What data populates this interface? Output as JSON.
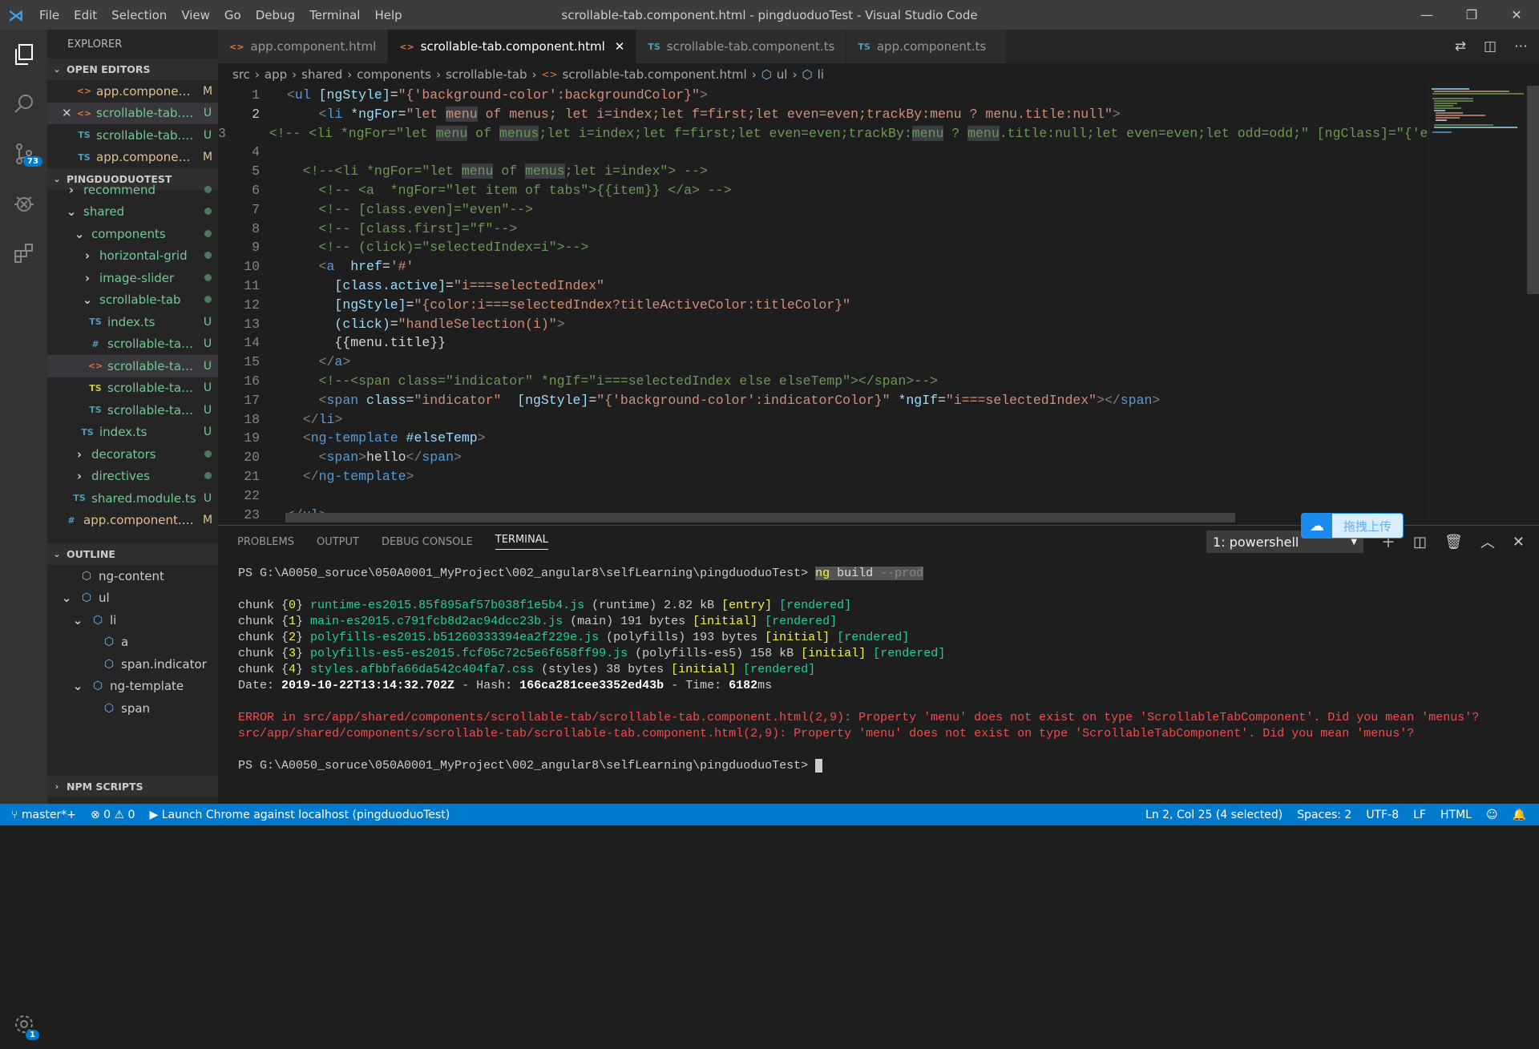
{
  "titlebar": {
    "menu": [
      "File",
      "Edit",
      "Selection",
      "View",
      "Go",
      "Debug",
      "Terminal",
      "Help"
    ],
    "title": "scrollable-tab.component.html - pingduoduoTest - Visual Studio Code"
  },
  "activity": {
    "scm_badge": "73",
    "settings_badge": "1"
  },
  "sidebar": {
    "header": "EXPLORER",
    "open_editors_label": "OPEN EDITORS",
    "open_editors": [
      {
        "icon": "<>",
        "label": "app.component.html",
        "status": "M",
        "cls": "m",
        "ic": "#e37933"
      },
      {
        "icon": "<>",
        "label": "scrollable-tab.component.html",
        "status": "U",
        "cls": "u",
        "ic": "#e37933",
        "selected": true
      },
      {
        "icon": "TS",
        "label": "scrollable-tab.component.ts",
        "status": "U",
        "cls": "u",
        "ic": "#519aba"
      },
      {
        "icon": "TS",
        "label": "app.component.ts",
        "status": "M",
        "cls": "m",
        "ic": "#519aba"
      }
    ],
    "project_label": "PINGDUODUOTEST",
    "tree": [
      {
        "indent": 2,
        "chev": ">",
        "label": "recommend",
        "status": "dot"
      },
      {
        "indent": 2,
        "chev": "v",
        "label": "shared",
        "status": "dot"
      },
      {
        "indent": 3,
        "chev": "v",
        "label": "components",
        "status": "dot"
      },
      {
        "indent": 4,
        "chev": ">",
        "label": "horizontal-grid",
        "status": "dot"
      },
      {
        "indent": 4,
        "chev": ">",
        "label": "image-slider",
        "status": "dot"
      },
      {
        "indent": 4,
        "chev": "v",
        "label": "scrollable-tab",
        "status": "dot"
      },
      {
        "indent": 5,
        "icon": "TS",
        "ic": "#519aba",
        "label": "index.ts",
        "status": "U"
      },
      {
        "indent": 5,
        "icon": "#",
        "ic": "#519aba",
        "label": "scrollable-tab.component.css",
        "status": "U"
      },
      {
        "indent": 5,
        "icon": "<>",
        "ic": "#e37933",
        "label": "scrollable-tab.component.html",
        "status": "U",
        "selected": true
      },
      {
        "indent": 5,
        "icon": "TS",
        "ic": "#cbcb41",
        "label": "scrollable-tab.component.spec.ts",
        "status": "U"
      },
      {
        "indent": 5,
        "icon": "TS",
        "ic": "#519aba",
        "label": "scrollable-tab.component.ts",
        "status": "U"
      },
      {
        "indent": 4,
        "icon": "TS",
        "ic": "#519aba",
        "label": "index.ts",
        "status": "U"
      },
      {
        "indent": 3,
        "chev": ">",
        "label": "decorators",
        "status": "dot"
      },
      {
        "indent": 3,
        "chev": ">",
        "label": "directives",
        "status": "dot"
      },
      {
        "indent": 3,
        "icon": "TS",
        "ic": "#519aba",
        "label": "shared.module.ts",
        "status": "U"
      },
      {
        "indent": 2,
        "icon": "#",
        "ic": "#519aba",
        "label": "app.component.css",
        "status": "M",
        "m": true
      }
    ],
    "outline_label": "OUTLINE",
    "outline": [
      {
        "indent": 1,
        "label": "ng-content"
      },
      {
        "indent": 1,
        "chev": "v",
        "label": "ul"
      },
      {
        "indent": 2,
        "chev": "v",
        "label": "li"
      },
      {
        "indent": 3,
        "label": "a"
      },
      {
        "indent": 3,
        "label": "span.indicator"
      },
      {
        "indent": 2,
        "chev": "v",
        "label": "ng-template"
      },
      {
        "indent": 3,
        "label": "span"
      }
    ],
    "npm_label": "NPM SCRIPTS"
  },
  "tabs": [
    {
      "icon": "<>",
      "ic": "#e37933",
      "label": "app.component.html"
    },
    {
      "icon": "<>",
      "ic": "#e37933",
      "label": "scrollable-tab.component.html",
      "active": true
    },
    {
      "icon": "TS",
      "ic": "#519aba",
      "label": "scrollable-tab.component.ts"
    },
    {
      "icon": "TS",
      "ic": "#519aba",
      "label": "app.component.ts"
    }
  ],
  "breadcrumb": [
    "src",
    "app",
    "shared",
    "components",
    "scrollable-tab",
    "scrollable-tab.component.html",
    "ul",
    "li"
  ],
  "code": [
    [
      [
        "<",
        "p"
      ],
      [
        "ul",
        "tag"
      ],
      [
        " ",
        ""
      ],
      [
        "[ngStyle]",
        "attr"
      ],
      [
        "=",
        "tx"
      ],
      [
        "\"{'background-color':backgroundColor}\"",
        "str"
      ],
      [
        ">",
        "p"
      ]
    ],
    [
      [
        "    ",
        ""
      ],
      [
        "<",
        "p"
      ],
      [
        "li",
        "tag"
      ],
      [
        " ",
        ""
      ],
      [
        "*ngFor",
        "attr"
      ],
      [
        "=",
        "tx"
      ],
      [
        "\"let ",
        "str"
      ],
      [
        "menu",
        "str hl"
      ],
      [
        " of ",
        "str"
      ],
      [
        "menus",
        "str"
      ],
      [
        "; let i=index;let f=first;let even=even;trackBy:",
        "str"
      ],
      [
        "menu",
        "str"
      ],
      [
        " ? ",
        "str"
      ],
      [
        "menu",
        "str"
      ],
      [
        ".title:null\"",
        "str"
      ],
      [
        ">",
        "p"
      ]
    ],
    [
      [
        "  <!-- <li *ngFor=\"let ",
        "cm"
      ],
      [
        "menu",
        "cm hl"
      ],
      [
        " of ",
        "cm"
      ],
      [
        "menus",
        "cm hl"
      ],
      [
        ";let i=index;let f=first;let even=even;trackBy:",
        "cm"
      ],
      [
        "menu",
        "cm hl"
      ],
      [
        " ? ",
        "cm"
      ],
      [
        "menu",
        "cm hl"
      ],
      [
        ".title:null;let even=even;let odd=odd;\" [ngClass]=\"{'ev",
        "cm"
      ]
    ],
    [],
    [
      [
        "  <!--<li *ngFor=\"let ",
        "cm"
      ],
      [
        "menu",
        "cm hl"
      ],
      [
        " of ",
        "cm"
      ],
      [
        "menus",
        "cm hl"
      ],
      [
        ";let i=index\"> -->",
        "cm"
      ]
    ],
    [
      [
        "    <!-- <a  *ngFor=\"let item of tabs\">{{item}} </a> -->",
        "cm"
      ]
    ],
    [
      [
        "    <!-- [class.even]=\"even\"-->",
        "cm"
      ]
    ],
    [
      [
        "    <!-- [class.first]=\"f\"-->",
        "cm"
      ]
    ],
    [
      [
        "    <!-- (click)=\"selectedIndex=i\">-->",
        "cm"
      ]
    ],
    [
      [
        "    ",
        ""
      ],
      [
        "<",
        "p"
      ],
      [
        "a",
        "tag"
      ],
      [
        "  ",
        ""
      ],
      [
        "href",
        "attr"
      ],
      [
        "=",
        "tx"
      ],
      [
        "'#'",
        "str"
      ]
    ],
    [
      [
        "      ",
        ""
      ],
      [
        "[class.active]",
        "attr"
      ],
      [
        "=",
        "tx"
      ],
      [
        "\"i===selectedIndex\"",
        "str"
      ]
    ],
    [
      [
        "      ",
        ""
      ],
      [
        "[ngStyle]",
        "attr"
      ],
      [
        "=",
        "tx"
      ],
      [
        "\"{color:i===selectedIndex?titleActiveColor:titleColor}\"",
        "str"
      ]
    ],
    [
      [
        "      ",
        ""
      ],
      [
        "(click)",
        "attr"
      ],
      [
        "=",
        "tx"
      ],
      [
        "\"handleSelection(i)\"",
        "str"
      ],
      [
        ">",
        "p"
      ]
    ],
    [
      [
        "      {{menu.title}}",
        "tx"
      ]
    ],
    [
      [
        "    ",
        ""
      ],
      [
        "</",
        "p"
      ],
      [
        "a",
        "tag"
      ],
      [
        ">",
        "p"
      ]
    ],
    [
      [
        "    <!--<span class=\"indicator\" *ngIf=\"i===selectedIndex else elseTemp\"></span>-->",
        "cm"
      ]
    ],
    [
      [
        "    ",
        ""
      ],
      [
        "<",
        "p"
      ],
      [
        "span",
        "tag"
      ],
      [
        " ",
        ""
      ],
      [
        "class",
        "attr"
      ],
      [
        "=",
        "tx"
      ],
      [
        "\"indicator\"",
        "str"
      ],
      [
        "  ",
        ""
      ],
      [
        "[ngStyle]",
        "attr"
      ],
      [
        "=",
        "tx"
      ],
      [
        "\"{'background-color':indicatorColor}\"",
        "str"
      ],
      [
        " ",
        ""
      ],
      [
        "*ngIf",
        "attr"
      ],
      [
        "=",
        "tx"
      ],
      [
        "\"i===selectedIndex\"",
        "str"
      ],
      [
        "></",
        "p"
      ],
      [
        "span",
        "tag"
      ],
      [
        ">",
        "p"
      ]
    ],
    [
      [
        "  ",
        ""
      ],
      [
        "</",
        "p"
      ],
      [
        "li",
        "tag"
      ],
      [
        ">",
        "p"
      ]
    ],
    [
      [
        "  ",
        ""
      ],
      [
        "<",
        "p"
      ],
      [
        "ng-template",
        "tag"
      ],
      [
        " ",
        ""
      ],
      [
        "#elseTemp",
        "attr"
      ],
      [
        ">",
        "p"
      ]
    ],
    [
      [
        "    ",
        ""
      ],
      [
        "<",
        "p"
      ],
      [
        "span",
        "tag"
      ],
      [
        ">",
        "p"
      ],
      [
        "hello",
        "tx"
      ],
      [
        "</",
        "p"
      ],
      [
        "span",
        "tag"
      ],
      [
        ">",
        "p"
      ]
    ],
    [
      [
        "  ",
        ""
      ],
      [
        "</",
        "p"
      ],
      [
        "ng-template",
        "tag"
      ],
      [
        ">",
        "p"
      ]
    ],
    [],
    [
      [
        "</",
        "p"
      ],
      [
        "ul",
        "tag"
      ],
      [
        ">",
        "p"
      ]
    ]
  ],
  "cursor_line": 2,
  "panel": {
    "tabs": [
      "PROBLEMS",
      "OUTPUT",
      "DEBUG CONSOLE",
      "TERMINAL"
    ],
    "active": "TERMINAL",
    "shell": "1: powershell",
    "upload_label": "拖拽上传"
  },
  "terminal": [
    [
      [
        "PS G:\\A0050_soruce\\050A0001_MyProject\\002_angular8\\selfLearning\\pingduoduoTest> ",
        "t-w"
      ],
      [
        "ng",
        "t-hl"
      ],
      [
        " build ",
        "t-hlw"
      ],
      [
        "--prod",
        "t-dim"
      ]
    ],
    [],
    [
      [
        "chunk {",
        "t-w"
      ],
      [
        "0",
        "t-y"
      ],
      [
        "} ",
        "t-w"
      ],
      [
        "runtime-es2015.85f895af57b038f1e5b4.js",
        "t-g"
      ],
      [
        " (runtime) 2.82 kB ",
        "t-w"
      ],
      [
        "[entry]",
        "t-y"
      ],
      [
        " ",
        "t-w"
      ],
      [
        "[rendered]",
        "t-g"
      ]
    ],
    [
      [
        "chunk {",
        "t-w"
      ],
      [
        "1",
        "t-y"
      ],
      [
        "} ",
        "t-w"
      ],
      [
        "main-es2015.c791fcb8d2ac94dcc23b.js",
        "t-g"
      ],
      [
        " (main) 191 bytes ",
        "t-w"
      ],
      [
        "[initial]",
        "t-y"
      ],
      [
        " ",
        "t-w"
      ],
      [
        "[rendered]",
        "t-g"
      ]
    ],
    [
      [
        "chunk {",
        "t-w"
      ],
      [
        "2",
        "t-y"
      ],
      [
        "} ",
        "t-w"
      ],
      [
        "polyfills-es2015.b51260333394ea2f229e.js",
        "t-g"
      ],
      [
        " (polyfills) 193 bytes ",
        "t-w"
      ],
      [
        "[initial]",
        "t-y"
      ],
      [
        " ",
        "t-w"
      ],
      [
        "[rendered]",
        "t-g"
      ]
    ],
    [
      [
        "chunk {",
        "t-w"
      ],
      [
        "3",
        "t-y"
      ],
      [
        "} ",
        "t-w"
      ],
      [
        "polyfills-es5-es2015.fcf05c72c5e6f658ff99.js",
        "t-g"
      ],
      [
        " (polyfills-es5) 158 kB ",
        "t-w"
      ],
      [
        "[initial]",
        "t-y"
      ],
      [
        " ",
        "t-w"
      ],
      [
        "[rendered]",
        "t-g"
      ]
    ],
    [
      [
        "chunk {",
        "t-w"
      ],
      [
        "4",
        "t-y"
      ],
      [
        "} ",
        "t-w"
      ],
      [
        "styles.afbbfa66da542c404fa7.css",
        "t-g"
      ],
      [
        " (styles) 38 bytes ",
        "t-w"
      ],
      [
        "[initial]",
        "t-y"
      ],
      [
        " ",
        "t-w"
      ],
      [
        "[rendered]",
        "t-g"
      ]
    ],
    [
      [
        "Date: ",
        "t-w"
      ],
      [
        "2019-10-22T13:14:32.702Z",
        "t-b"
      ],
      [
        " - Hash: ",
        "t-w"
      ],
      [
        "166ca281cee3352ed43b",
        "t-b"
      ],
      [
        " - Time: ",
        "t-w"
      ],
      [
        "6182",
        "t-b"
      ],
      [
        "ms",
        "t-w"
      ]
    ],
    [],
    [
      [
        "ERROR in src/app/shared/components/scrollable-tab/scrollable-tab.component.html(2,9): Property 'menu' does not exist on type 'ScrollableTabComponent'. Did you mean 'menus'?",
        "t-r"
      ]
    ],
    [
      [
        "src/app/shared/components/scrollable-tab/scrollable-tab.component.html(2,9): Property 'menu' does not exist on type 'ScrollableTabComponent'. Did you mean 'menus'?",
        "t-r"
      ]
    ],
    [],
    [
      [
        "PS G:\\A0050_soruce\\050A0001_MyProject\\002_angular8\\selfLearning\\pingduoduoTest> ",
        "t-w"
      ]
    ]
  ],
  "status": {
    "branch": "master*+",
    "errors": "0",
    "warnings": "0",
    "launch": "Launch Chrome against localhost (pingduoduoTest)",
    "position": "Ln 2, Col 25 (4 selected)",
    "spaces": "Spaces: 2",
    "encoding": "UTF-8",
    "eol": "LF",
    "language": "HTML"
  }
}
